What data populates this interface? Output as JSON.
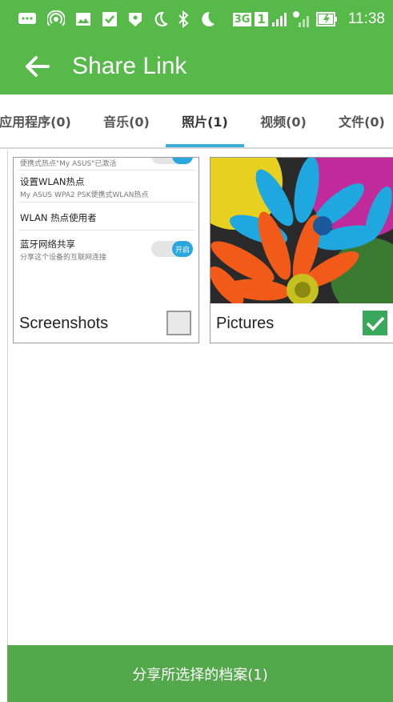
{
  "status_bar": {
    "time": "11:38",
    "network_label": "3G",
    "sim_label": "1",
    "icons": [
      "message-icon",
      "hotspot-icon",
      "gallery-icon",
      "checkbox-icon",
      "shield-icon",
      "moon-icon",
      "bluetooth-icon",
      "moon-icon",
      "network-3g-icon",
      "sim-1-icon",
      "signal-icon",
      "signal-off-icon",
      "battery-charging-icon"
    ]
  },
  "app_bar": {
    "title": "Share Link",
    "back_icon": "arrow-left-icon"
  },
  "tabs": [
    {
      "label": "应用程序(0)",
      "active": false
    },
    {
      "label": "音乐(0)",
      "active": false
    },
    {
      "label": "照片(1)",
      "active": true
    },
    {
      "label": "视频(0)",
      "active": false
    },
    {
      "label": "文件(0)",
      "active": false
    }
  ],
  "albums": [
    {
      "name": "Screenshots",
      "checked": false,
      "preview": {
        "row1_sub": "便携式热点\"My ASUS\"已激活",
        "row2_main": "设置WLAN热点",
        "row2_sub": "My ASUS WPA2 PSK便携式WLAN热点",
        "row3_main": "WLAN 热点使用者",
        "row4_main": "蓝牙网络共享",
        "row4_sub": "分享这个设备的互联网连接",
        "toggle_label": "开启"
      }
    },
    {
      "name": "Pictures",
      "checked": true
    }
  ],
  "share_button": "分享所选择的档案(1)",
  "colors": {
    "primary": "#56b94a",
    "button": "#52a84a",
    "tab_indicator": "#3ab0d8",
    "check": "#3aa85a"
  }
}
